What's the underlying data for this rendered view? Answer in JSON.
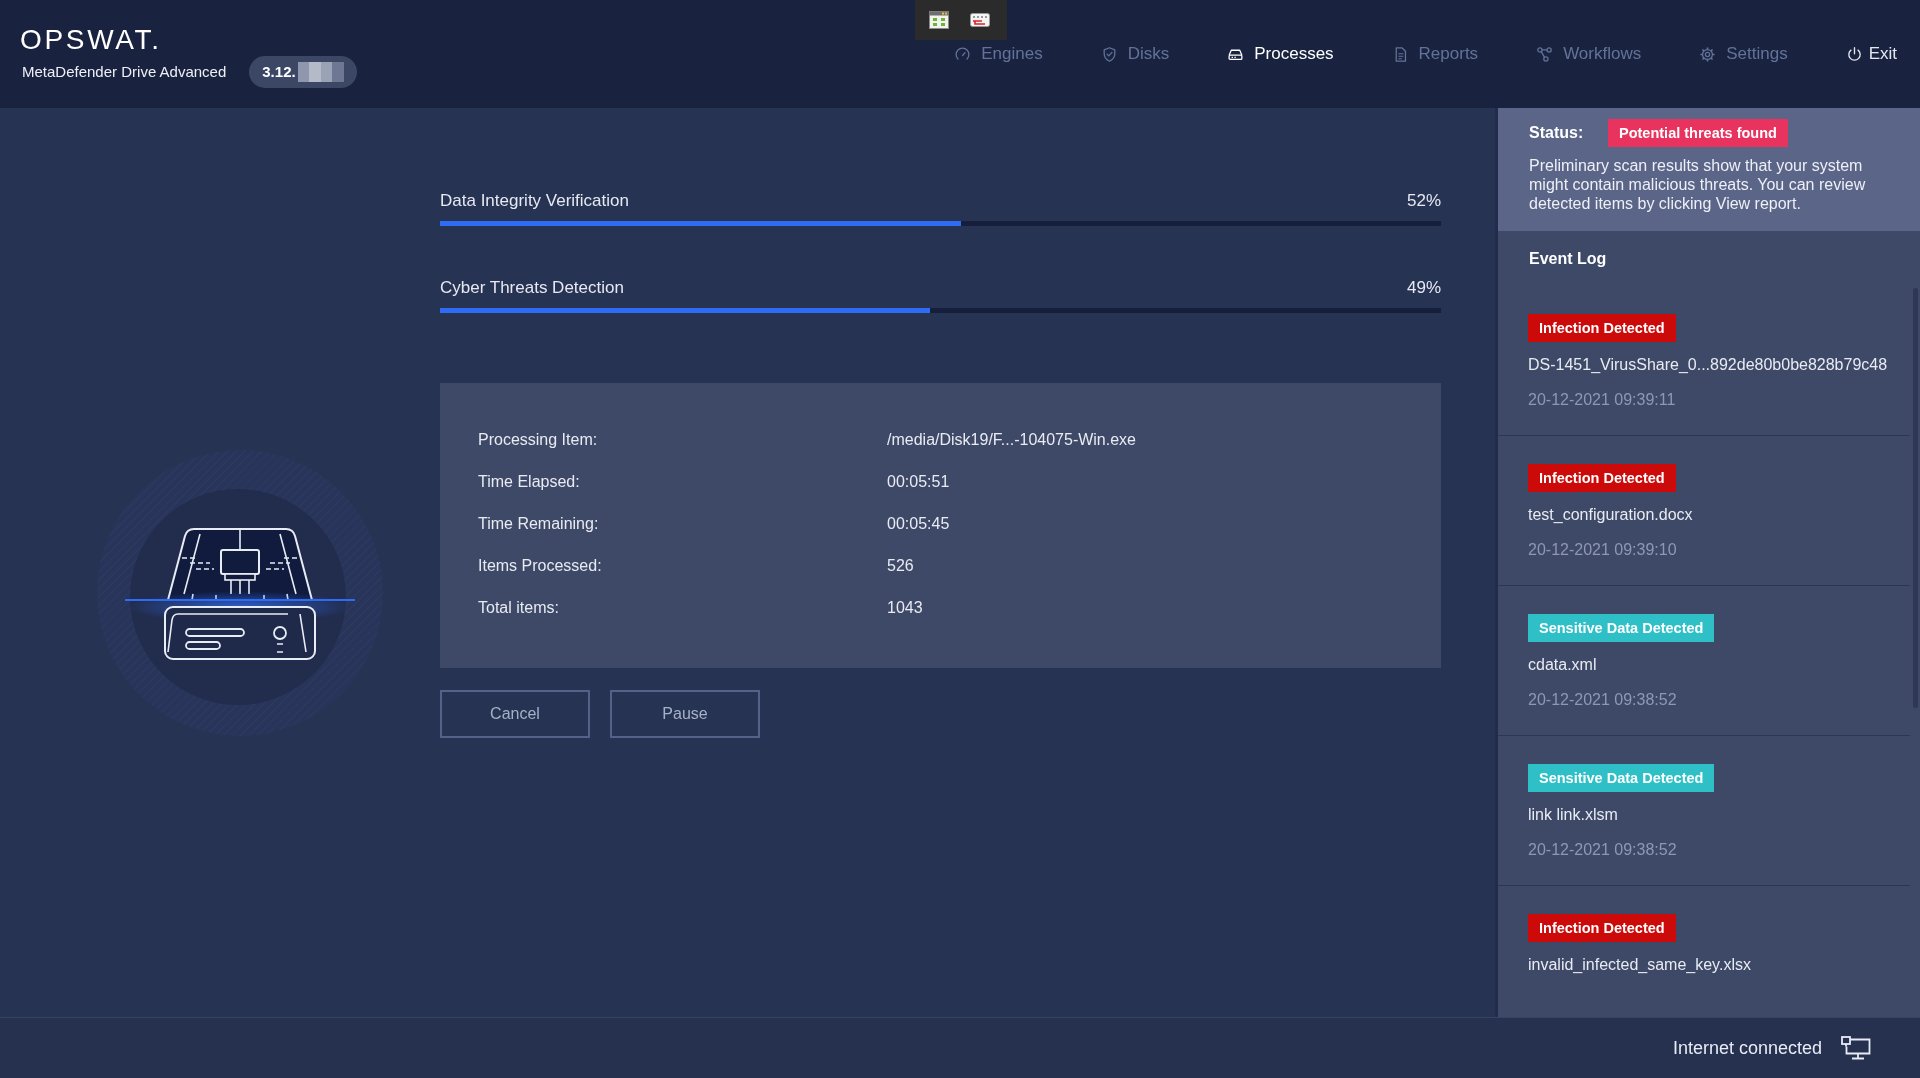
{
  "header": {
    "logo": "OPSWAT.",
    "product": "MetaDefender Drive Advanced",
    "version": "3.12."
  },
  "nav": [
    {
      "label": "Engines",
      "selected": false
    },
    {
      "label": "Disks",
      "selected": false
    },
    {
      "label": "Processes",
      "selected": true
    },
    {
      "label": "Reports",
      "selected": false
    },
    {
      "label": "Workflows",
      "selected": false
    },
    {
      "label": "Settings",
      "selected": false
    }
  ],
  "exit": {
    "label": "Exit"
  },
  "progress": [
    {
      "label": "Data Integrity Verification",
      "level": 0.52,
      "reading": "52%"
    },
    {
      "label": "Cyber Threats Detection",
      "level": 0.49,
      "reading": "49%"
    }
  ],
  "details": [
    {
      "label": "Processing Item:",
      "value": "/media/Disk19/F...-104075-Win.exe"
    },
    {
      "label": "Time Elapsed:",
      "value": "00:05:51"
    },
    {
      "label": "Time Remaining:",
      "value": "00:05:45"
    },
    {
      "label": "Items Processed:",
      "value": "526"
    },
    {
      "label": "Total items:",
      "value": "1043"
    }
  ],
  "buttons": [
    "Cancel",
    "Pause"
  ],
  "status": {
    "label": "Status:",
    "badge": "Potential threats found",
    "description": "Preliminary scan results show that your system might contain malicious threats. You can review detected items by clicking View report."
  },
  "event_log": {
    "title": "Event Log",
    "events": [
      {
        "badge": "Infection Detected",
        "color": "#cc0a0a",
        "file": "DS-1451_VirusShare_0...892de80b0be828b79c48",
        "time": "20-12-2021 09:39:11"
      },
      {
        "badge": "Infection Detected",
        "color": "#cc0a0a",
        "file": "test_configuration.docx",
        "time": "20-12-2021 09:39:10"
      },
      {
        "badge": "Sensitive Data Detected",
        "color": "#2fc0c7",
        "file": "cdata.xml",
        "time": "20-12-2021 09:38:52"
      },
      {
        "badge": "Sensitive Data Detected",
        "color": "#2fc0c7",
        "file": "link link.xlsm",
        "time": "20-12-2021 09:38:52"
      },
      {
        "badge": "Infection Detected",
        "color": "#cc0a0a",
        "file": "invalid_infected_same_key.xlsx"
      }
    ]
  },
  "footer": {
    "connection": "Internet connected"
  }
}
